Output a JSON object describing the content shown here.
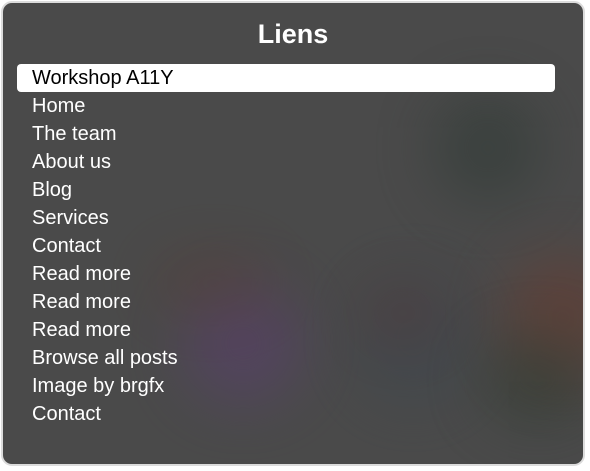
{
  "rotor": {
    "title": "Liens",
    "selected_index": 0,
    "items": [
      {
        "label": "Workshop A11Y"
      },
      {
        "label": "Home"
      },
      {
        "label": "The team"
      },
      {
        "label": "About us"
      },
      {
        "label": "Blog"
      },
      {
        "label": "Services"
      },
      {
        "label": "Contact"
      },
      {
        "label": "Read more"
      },
      {
        "label": "Read more"
      },
      {
        "label": "Read more"
      },
      {
        "label": "Browse all posts"
      },
      {
        "label": "Image by brgfx"
      },
      {
        "label": "Contact"
      }
    ]
  },
  "colors": {
    "panel_background": "#4a4a4a",
    "text": "#ffffff",
    "selected_background": "#ffffff",
    "selected_text": "#000000"
  }
}
